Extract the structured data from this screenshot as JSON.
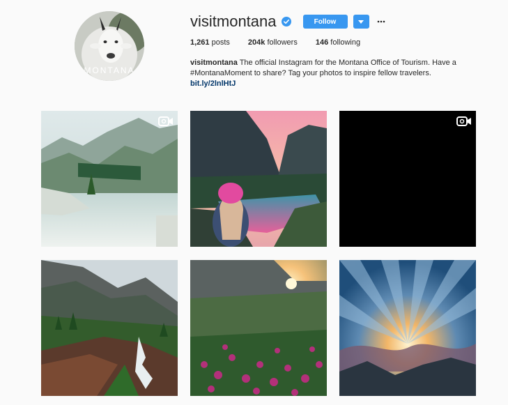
{
  "profile": {
    "username": "visitmontana",
    "avatar_text": "MONTANA",
    "follow_label": "Follow",
    "verified_icon": "verified-badge-icon",
    "more_icon": "ellipsis-icon"
  },
  "stats": {
    "posts_count": "1,261",
    "posts_label": "posts",
    "followers_count": "204k",
    "followers_label": "followers",
    "following_count": "146",
    "following_label": "following"
  },
  "bio": {
    "name": "visitmontana",
    "text_line1": " The official Instagram for the Montana Office of Tourism. Have a",
    "text_line2": "#MontanaMoment to share? Tag your photos to inspire fellow travelers.",
    "link": "bit.ly/2lnlHtJ"
  },
  "posts": [
    {
      "scene": "mountain-lake-reflection",
      "is_video": true
    },
    {
      "scene": "woman-pink-hat-alpine-lake",
      "is_video": false
    },
    {
      "scene": "black-video-frame",
      "is_video": true
    },
    {
      "scene": "waterfall-forest-valley",
      "is_video": false
    },
    {
      "scene": "wildflowers-sunburst",
      "is_video": false
    },
    {
      "scene": "sun-rays-clouds-sunset",
      "is_video": false
    }
  ],
  "colors": {
    "accent": "#3897f0",
    "link": "#003569",
    "background": "#fafafa"
  }
}
